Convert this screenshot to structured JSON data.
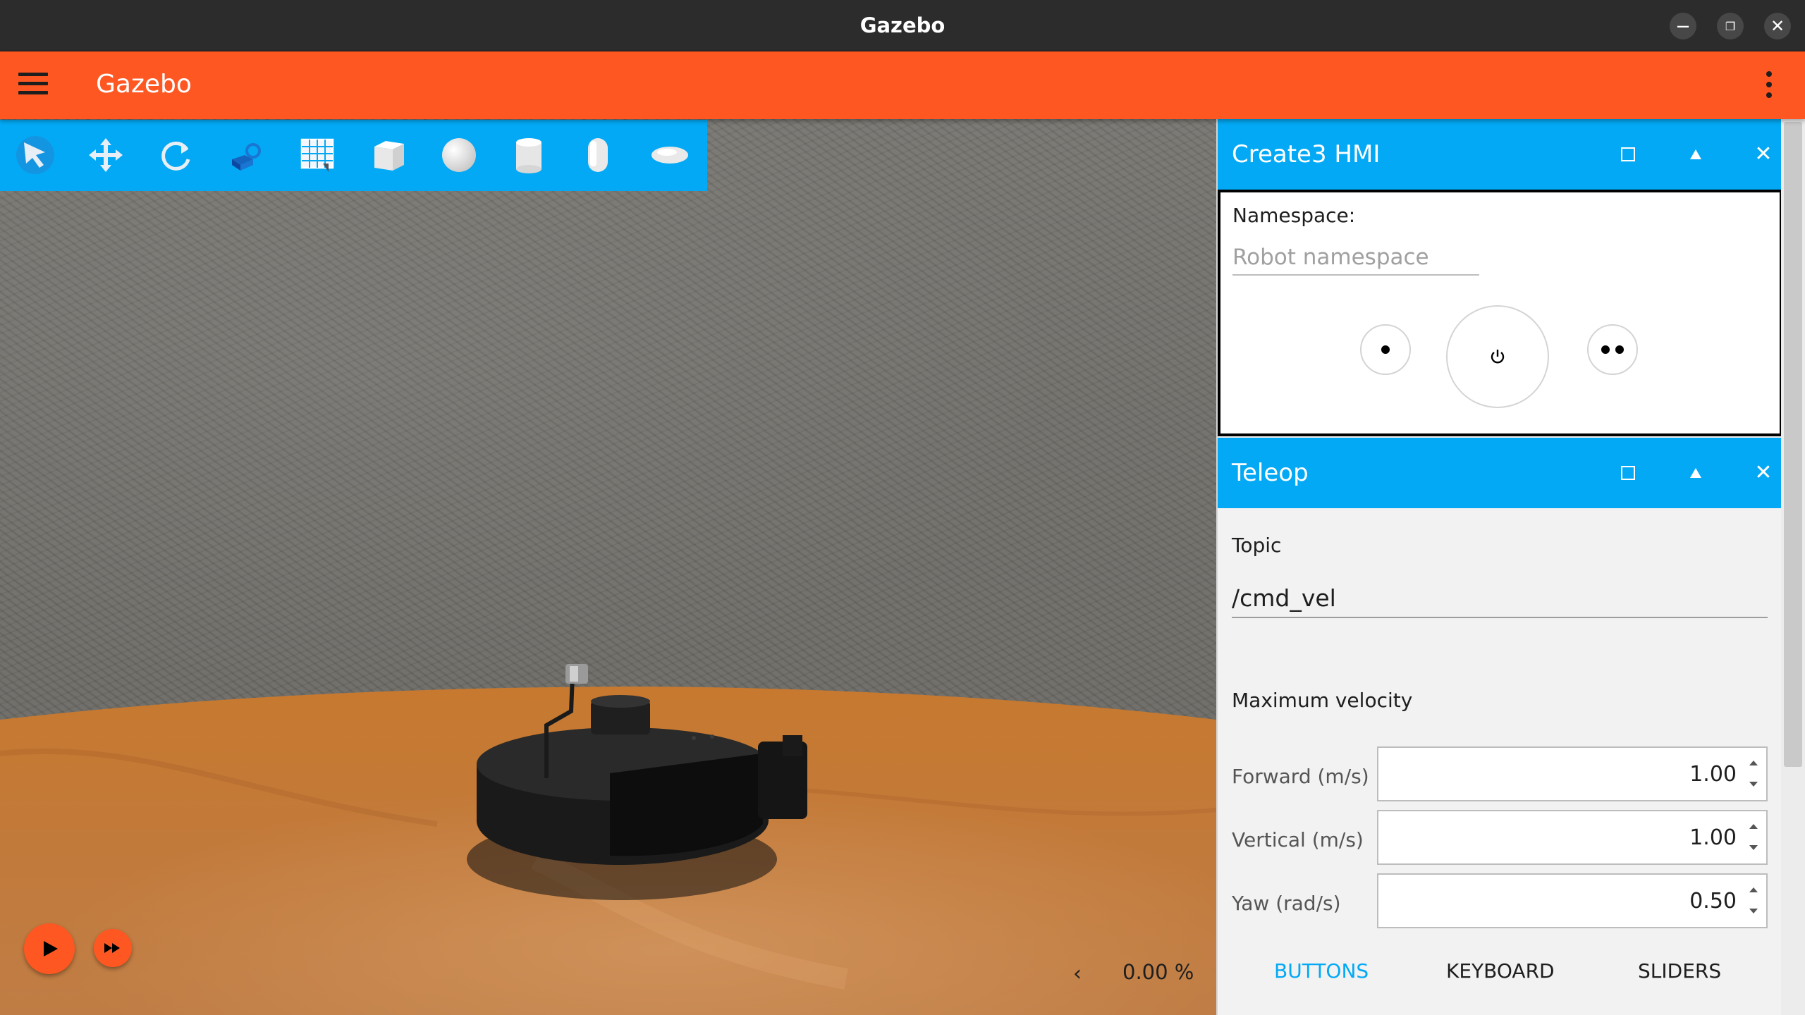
{
  "window": {
    "title": "Gazebo",
    "controls": [
      "minimize",
      "restore",
      "close"
    ]
  },
  "appbar": {
    "title": "Gazebo"
  },
  "toolbar": {
    "tools": [
      {
        "name": "select-tool-icon"
      },
      {
        "name": "translate-tool-icon"
      },
      {
        "name": "rotate-tool-icon"
      },
      {
        "name": "transform-control-icon"
      },
      {
        "name": "grid-snap-icon"
      },
      {
        "name": "box-shape-icon"
      },
      {
        "name": "sphere-shape-icon"
      },
      {
        "name": "cylinder-shape-icon"
      },
      {
        "name": "capsule-shape-icon"
      },
      {
        "name": "ellipsoid-shape-icon"
      }
    ]
  },
  "playback": {
    "rtf": "0.00 %",
    "chevron": "‹"
  },
  "hmi": {
    "title": "Create3 HMI",
    "namespace_label": "Namespace:",
    "namespace_placeholder": "Robot namespace",
    "namespace_value": ""
  },
  "teleop": {
    "title": "Teleop",
    "topic_label": "Topic",
    "topic_value": "/cmd_vel",
    "max_velocity_label": "Maximum velocity",
    "forward_label": "Forward (m/s)",
    "forward_value": "1.00",
    "vertical_label": "Vertical (m/s)",
    "vertical_value": "1.00",
    "yaw_label": "Yaw (rad/s)",
    "yaw_value": "0.50",
    "tabs": [
      "BUTTONS",
      "KEYBOARD",
      "SLIDERS"
    ],
    "active_tab": "BUTTONS"
  },
  "colors": {
    "appbar": "#ff5722",
    "toolbar": "#03a9f4",
    "card_header": "#03a9f4",
    "active_tab": "#03a9f4",
    "titlebar": "#2c2c2c"
  }
}
